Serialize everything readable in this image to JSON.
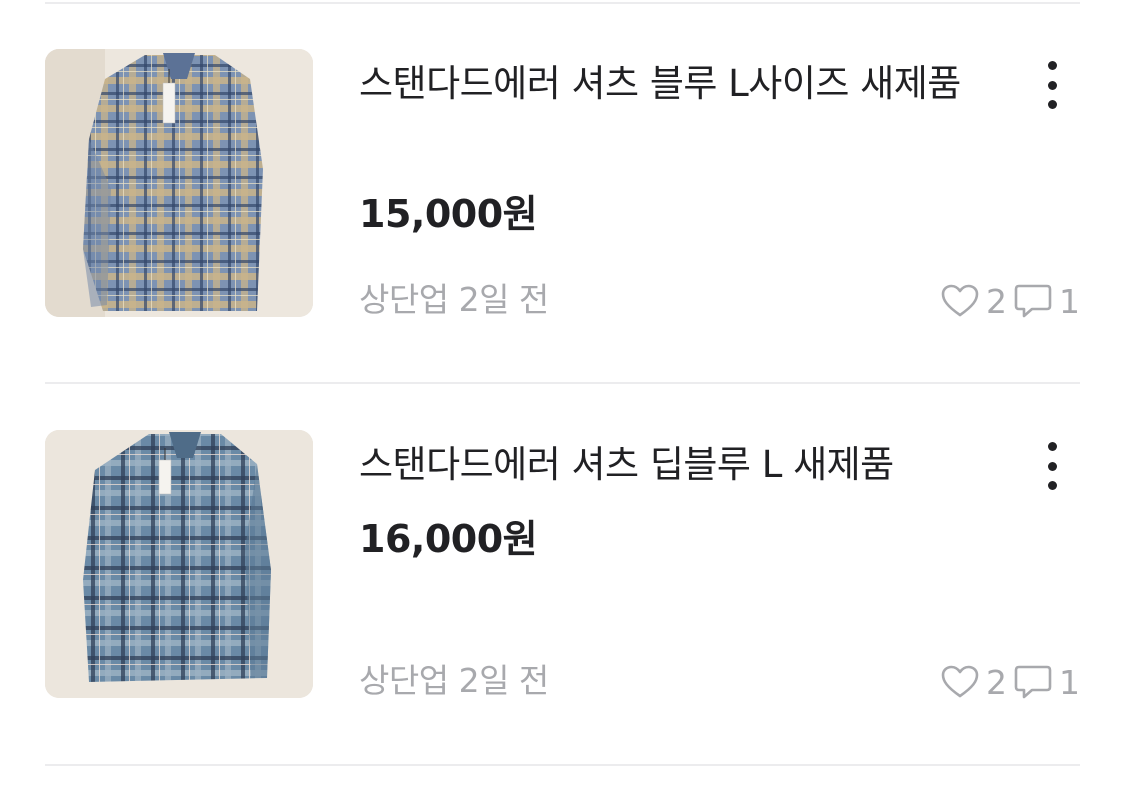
{
  "listings": [
    {
      "title": "스탠다드에러 셔츠 블루 L사이즈 새제품",
      "price": "15,000원",
      "meta": "상단업 2일 전",
      "likes": "2",
      "comments": "1",
      "image": "blue-yellow-plaid-shirt"
    },
    {
      "title": "스탠다드에러 셔츠 딥블루 L 새제품",
      "price": "16,000원",
      "meta": "상단업 2일 전",
      "likes": "2",
      "comments": "1",
      "image": "deep-blue-plaid-shirt"
    }
  ],
  "icons": {
    "more": "more-vertical-icon",
    "like": "heart-outline-icon",
    "comment": "chat-bubble-icon"
  },
  "colors": {
    "text": "#212124",
    "muted": "#a8a9ad",
    "divider": "#ececee"
  }
}
